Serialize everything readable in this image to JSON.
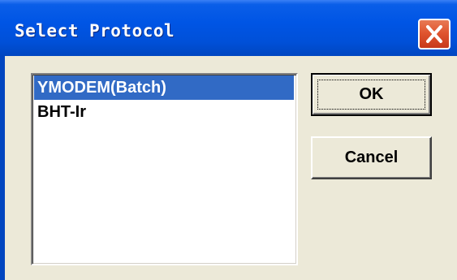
{
  "window": {
    "title": "Select Protocol"
  },
  "protocols": {
    "items": [
      {
        "label": "YMODEM(Batch)",
        "selected": true
      },
      {
        "label": "BHT-Ir",
        "selected": false
      }
    ]
  },
  "buttons": {
    "ok_label": "OK",
    "cancel_label": "Cancel"
  },
  "colors": {
    "titlebar": "#0055e5",
    "selection": "#316ac5",
    "close_button": "#e0552f",
    "dialog_face": "#ece9d8"
  },
  "icons": {
    "close": "close-icon"
  }
}
